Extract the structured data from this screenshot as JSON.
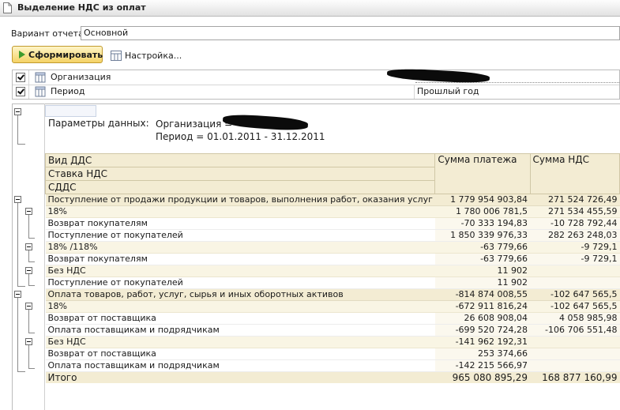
{
  "window": {
    "title": "Выделение НДС из оплат"
  },
  "variant": {
    "label": "Вариант отчета:",
    "value": "Основной"
  },
  "toolbar": {
    "generate_label": "Сформировать",
    "settings_label": "Настройка..."
  },
  "filters": [
    {
      "label": "Организация",
      "value": "",
      "checked": true
    },
    {
      "label": "Период",
      "value": "Прошлый год",
      "checked": true
    }
  ],
  "params": {
    "heading": "Параметры данных:",
    "organization": "Организация =",
    "period": "Период = 01.01.2011 - 31.12.2011"
  },
  "table": {
    "headers": {
      "row_groups": [
        "Вид ДДС",
        "Ставка НДС",
        "СДДС"
      ],
      "payment": "Сумма платежа",
      "vat": "Сумма НДС"
    },
    "rows": [
      {
        "level": 1,
        "label": "Поступление от продажи продукции и товаров, выполнения работ, оказания услуг",
        "payment": "1 779 954 903,84",
        "vat": "271 524 726,49"
      },
      {
        "level": 2,
        "label": "18%",
        "payment": "1 780 006 781,5",
        "vat": "271 534 455,59"
      },
      {
        "level": 3,
        "label": "Возврат покупателям",
        "payment": "-70 333 194,83",
        "vat": "-10 728 792,44"
      },
      {
        "level": 3,
        "label": "Поступление от покупателей",
        "payment": "1 850 339 976,33",
        "vat": "282 263 248,03"
      },
      {
        "level": 2,
        "label": "18% /118%",
        "payment": "-63 779,66",
        "vat": "-9 729,1"
      },
      {
        "level": 3,
        "label": "Возврат покупателям",
        "payment": "-63 779,66",
        "vat": "-9 729,1"
      },
      {
        "level": 2,
        "label": "Без НДС",
        "payment": "11 902",
        "vat": ""
      },
      {
        "level": 3,
        "label": "Поступление от покупателей",
        "payment": "11 902",
        "vat": ""
      },
      {
        "level": 1,
        "label": "Оплата товаров, работ, услуг, сырья и иных оборотных активов",
        "payment": "-814 874 008,55",
        "vat": "-102 647 565,5"
      },
      {
        "level": 2,
        "label": "18%",
        "payment": "-672 911 816,24",
        "vat": "-102 647 565,5"
      },
      {
        "level": 3,
        "label": "Возврат от поставщика",
        "payment": "26 608 908,04",
        "vat": "4 058 985,98"
      },
      {
        "level": 3,
        "label": "Оплата поставщикам и подрядчикам",
        "payment": "-699 520 724,28",
        "vat": "-106 706 551,48"
      },
      {
        "level": 2,
        "label": "Без НДС",
        "payment": "-141 962 192,31",
        "vat": ""
      },
      {
        "level": 3,
        "label": "Возврат от поставщика",
        "payment": "253 374,66",
        "vat": ""
      },
      {
        "level": 3,
        "label": "Оплата поставщикам и подрядчикам",
        "payment": "-142 215 566,97",
        "vat": ""
      }
    ],
    "total": {
      "label": "Итого",
      "payment": "965 080 895,29",
      "vat": "168 877 160,99"
    }
  }
}
